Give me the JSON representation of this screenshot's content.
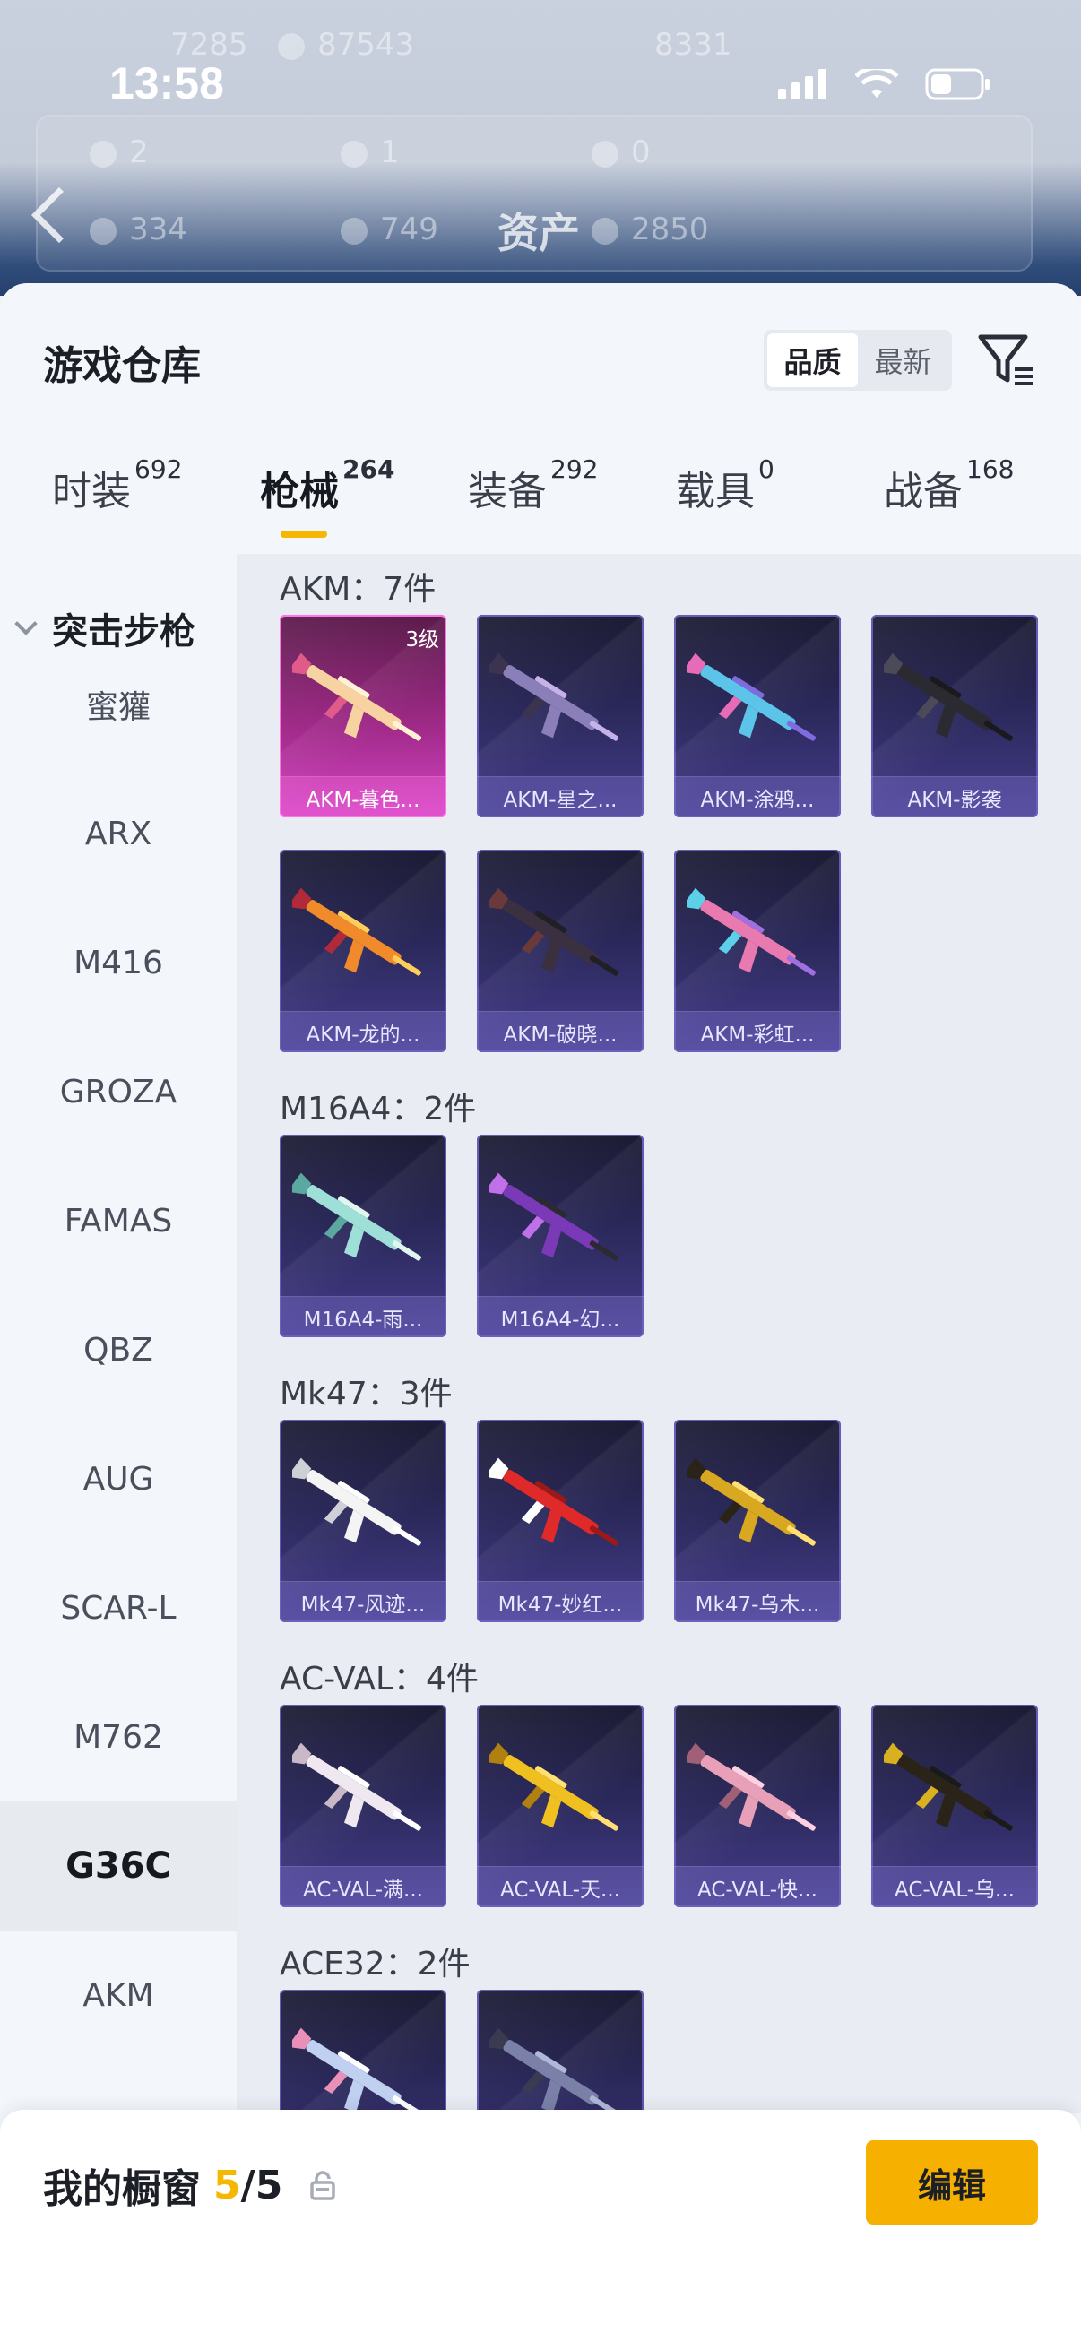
{
  "background_app": {
    "time": "13:58",
    "title": "资产",
    "stats_top": [
      "7285",
      "87543",
      "8331"
    ],
    "stats_mid": [
      "2",
      "1",
      "0"
    ],
    "stats_low": [
      "334",
      "749",
      "2850"
    ]
  },
  "warehouse": {
    "title": "游戏仓库",
    "sort": {
      "options": [
        "品质",
        "最新"
      ],
      "selected": "品质"
    }
  },
  "tabs": [
    {
      "label": "时装",
      "count": "692"
    },
    {
      "label": "枪械",
      "count": "264",
      "active": true
    },
    {
      "label": "装备",
      "count": "292"
    },
    {
      "label": "载具",
      "count": "0"
    },
    {
      "label": "战备",
      "count": "168"
    }
  ],
  "sidebar": {
    "group": "突击步枪",
    "items": [
      "蜜獾",
      "ARX",
      "M416",
      "GROZA",
      "FAMAS",
      "QBZ",
      "AUG",
      "SCAR-L",
      "M762",
      "G36C",
      "AKM"
    ],
    "selected": "G36C"
  },
  "groups": [
    {
      "title": "AKM：7件",
      "items": [
        {
          "name": "AKM-暮色...",
          "rarity": "pink",
          "level": "3级"
        },
        {
          "name": "AKM-星之..."
        },
        {
          "name": "AKM-涂鸦..."
        },
        {
          "name": "AKM-影袭"
        },
        {
          "name": "AKM-龙的..."
        },
        {
          "name": "AKM-破晓..."
        },
        {
          "name": "AKM-彩虹..."
        }
      ]
    },
    {
      "title": "M16A4：2件",
      "items": [
        {
          "name": "M16A4-雨..."
        },
        {
          "name": "M16A4-幻..."
        }
      ]
    },
    {
      "title": "Mk47：3件",
      "items": [
        {
          "name": "Mk47-风迹..."
        },
        {
          "name": "Mk47-妙红..."
        },
        {
          "name": "Mk47-乌木..."
        }
      ]
    },
    {
      "title": "AC-VAL：4件",
      "items": [
        {
          "name": "AC-VAL-满..."
        },
        {
          "name": "AC-VAL-天..."
        },
        {
          "name": "AC-VAL-快..."
        },
        {
          "name": "AC-VAL-乌..."
        }
      ]
    },
    {
      "title": "ACE32：2件",
      "items": [
        {
          "name": ""
        },
        {
          "name": ""
        }
      ]
    }
  ],
  "showcase": {
    "label": "我的橱窗",
    "count": "5",
    "slash": "/",
    "total": "5"
  },
  "edit_label": "编辑",
  "colors": {
    "accent": "#f5b700",
    "card_purple": "#453c8c",
    "card_pink": "#d444c4"
  },
  "icons": [
    "filter-icon",
    "share-icon",
    "lock-icon",
    "chevron-down-icon",
    "back-icon"
  ]
}
